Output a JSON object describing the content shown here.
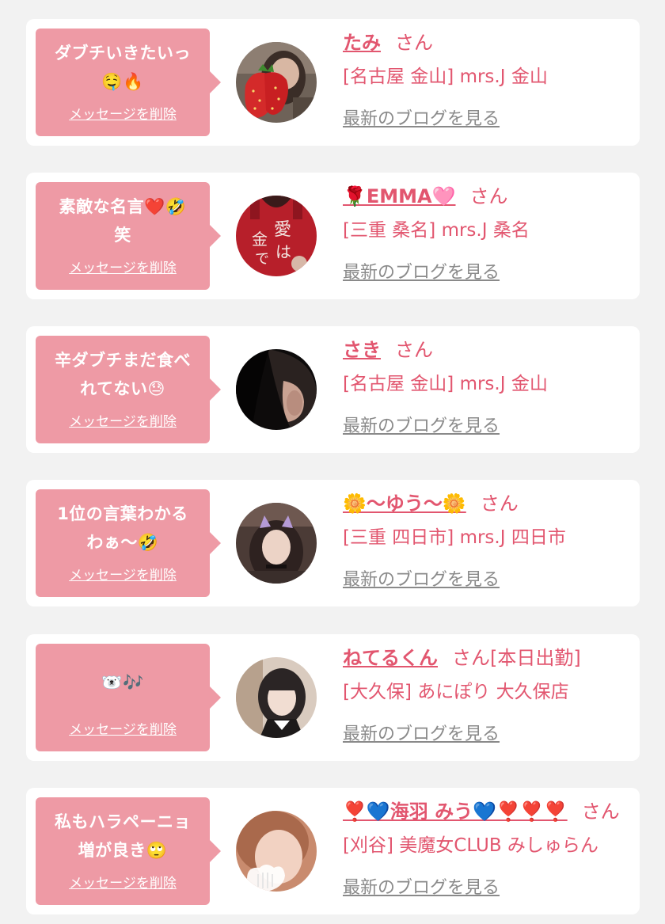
{
  "colors": {
    "background": "#f2f2f2",
    "card": "#ffffff",
    "bubble": "#ee9aa5",
    "accent": "#e2566f",
    "muted": "#8a8a8a"
  },
  "cards": [
    {
      "message": "ダブチいきたいっ\n🤤🔥",
      "delete_label": "メッセージを削除",
      "name": "たみ",
      "suffix": "さん",
      "shop": "[名古屋 金山] mrs.J 金山",
      "blog_label": "最新のブログを見る",
      "avatar": "avatar-strawberry"
    },
    {
      "message": "素敵な名言❤️🤣\n笑",
      "delete_label": "メッセージを削除",
      "name": "🌹EMMA🩷",
      "suffix": "さん",
      "shop": "[三重 桑名] mrs.J 桑名",
      "blog_label": "最新のブログを見る",
      "avatar": "avatar-red-hoodie"
    },
    {
      "message": "辛ダブチまだ食べ\nれてない😓",
      "delete_label": "メッセージを削除",
      "name": "さき",
      "suffix": "さん",
      "shop": "[名古屋 金山] mrs.J 金山",
      "blog_label": "最新のブログを見る",
      "avatar": "avatar-ear-closeup"
    },
    {
      "message": "1位の言葉わかる\nわぁ〜🤣",
      "delete_label": "メッセージを削除",
      "name": "🌼〜ゆう〜🌼",
      "suffix": "さん",
      "shop": "[三重 四日市] mrs.J 四日市",
      "blog_label": "最新のブログを見る",
      "avatar": "avatar-cat-ears"
    },
    {
      "message": "🐻‍❄️🎶",
      "delete_label": "メッセージを削除",
      "name": "ねてるくん",
      "suffix": "さん[本日出勤]",
      "shop": "[大久保] あにぽり 大久保店",
      "blog_label": "最新のブログを見る",
      "avatar": "avatar-maid"
    },
    {
      "message": "私もハラペーニョ\n増が良き🙄",
      "delete_label": "メッセージを削除",
      "name": "❣️💙海羽 みう💙❣️❣️❣️",
      "suffix": "さん",
      "shop": "[刈谷] 美魔女CLUB みしゅらん",
      "blog_label": "最新のブログを見る",
      "avatar": "avatar-heart-mask"
    }
  ]
}
